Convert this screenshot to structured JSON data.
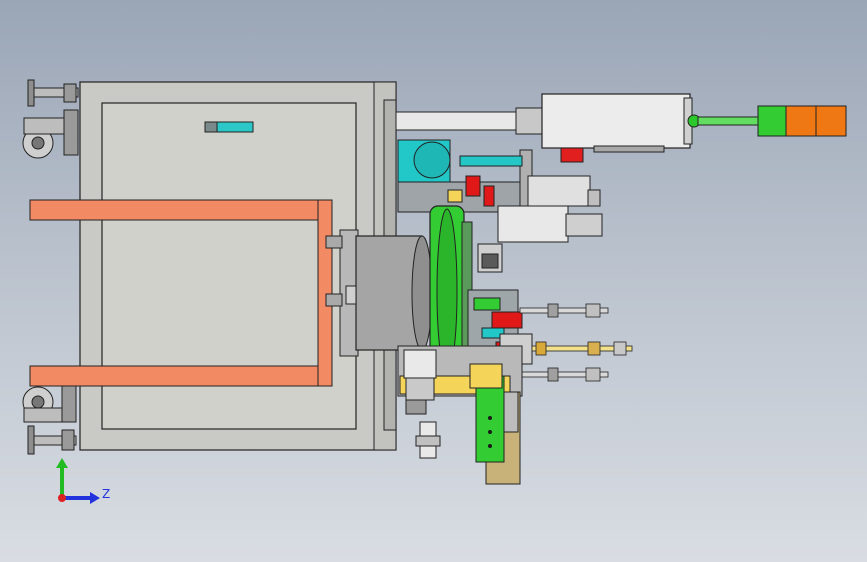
{
  "viewport": {
    "background": [
      "#9aa5b6",
      "#d9dde3"
    ],
    "model": "machine-assembly-side-view"
  },
  "triad": {
    "axis_z_label": "Z",
    "axis_colors": {
      "y": "#22bb22",
      "z": "#2233dd",
      "x": "#dd2222"
    }
  },
  "colors": {
    "frame": "#c9c9c6",
    "panel": "#d1d1cc",
    "fork": "#f28b64",
    "green": "#33cc33",
    "cyan": "#22c7c7",
    "orange": "#f07814",
    "red": "#e01818",
    "drum": "#a5a5a5",
    "yellow": "#f5d45a",
    "tan": "#c8b27a"
  }
}
